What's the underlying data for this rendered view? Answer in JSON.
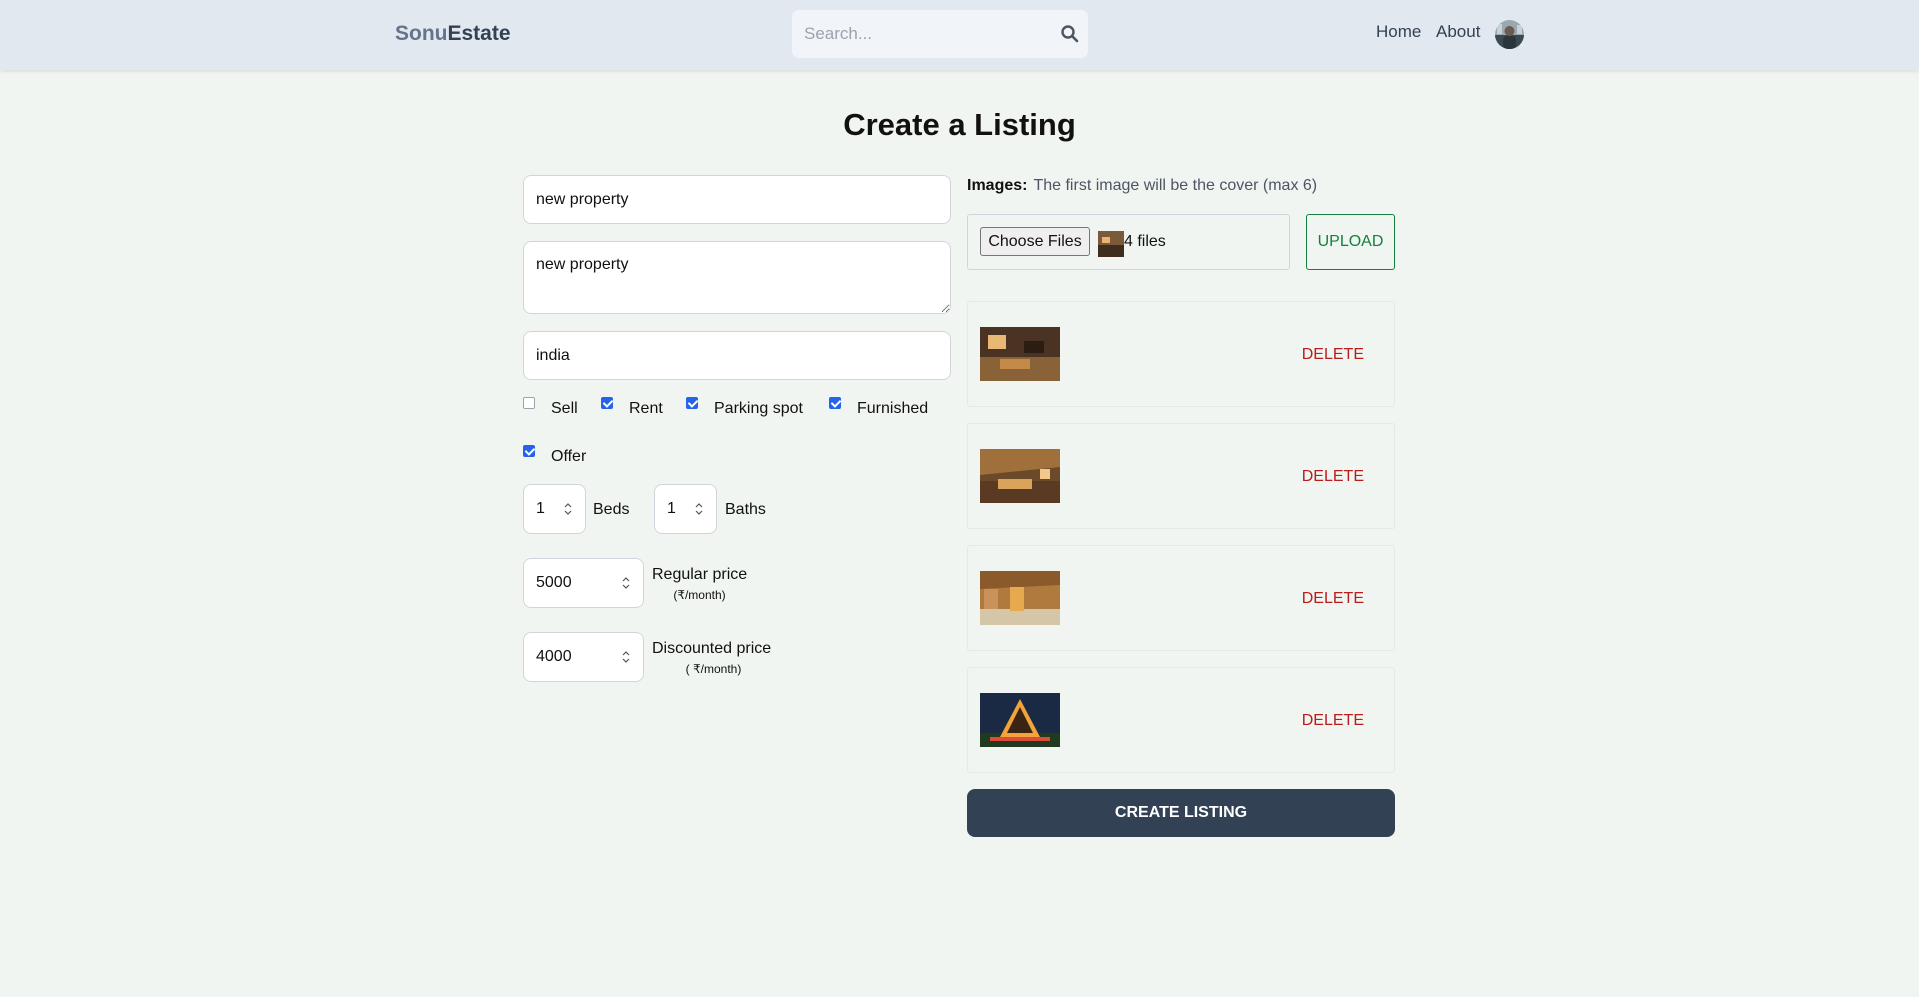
{
  "header": {
    "logo_part1": "Sonu",
    "logo_part2": "Estate",
    "search_placeholder": "Search...",
    "nav": [
      "Home",
      "About"
    ]
  },
  "page": {
    "title": "Create a Listing"
  },
  "form": {
    "name": "new property",
    "description": "new property",
    "address": "india",
    "checkboxes": [
      {
        "label": "Sell",
        "checked": false
      },
      {
        "label": "Rent",
        "checked": true
      },
      {
        "label": "Parking spot",
        "checked": true
      },
      {
        "label": "Furnished",
        "checked": true
      },
      {
        "label": "Offer",
        "checked": true
      }
    ],
    "beds": {
      "value": "1",
      "label": "Beds"
    },
    "baths": {
      "value": "1",
      "label": "Baths"
    },
    "regular_price": {
      "value": "5000",
      "label": "Regular price",
      "unit": "(₹/month)"
    },
    "discounted_price": {
      "value": "4000",
      "label": "Discounted price",
      "unit": "( ₹/month)"
    }
  },
  "images": {
    "label": "Images:",
    "note": "The first image will be the cover (max 6)",
    "choose_label": "Choose Files",
    "file_count": "4 files",
    "upload_label": "UPLOAD",
    "delete_label": "DELETE"
  },
  "submit_label": "CREATE LISTING",
  "colors": {
    "header_bg": "#e2e8f0",
    "page_bg": "#f1f5f1",
    "upload": "#15803d",
    "delete": "#b91c1c",
    "submit": "#334155"
  }
}
